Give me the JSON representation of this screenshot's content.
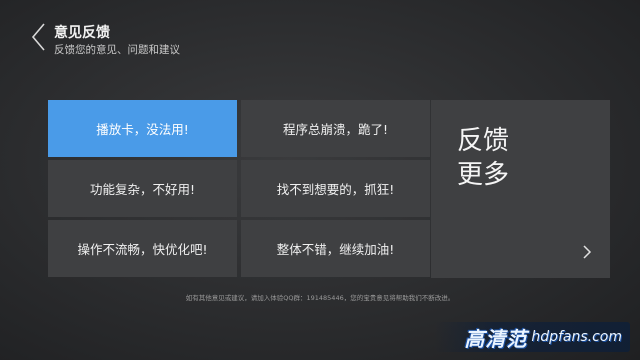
{
  "header": {
    "back_icon": "chevron-left-icon",
    "title": "意见反馈",
    "subtitle": "反馈您的意见、问题和建议"
  },
  "options": [
    {
      "label": "播放卡，没法用!",
      "selected": true
    },
    {
      "label": "程序总崩溃，跪了!",
      "selected": false
    },
    {
      "label": "功能复杂，不好用!",
      "selected": false
    },
    {
      "label": "找不到想要的，抓狂!",
      "selected": false
    },
    {
      "label": "操作不流畅，快优化吧!",
      "selected": false
    },
    {
      "label": "整体不错，继续加油!",
      "selected": false
    }
  ],
  "more": {
    "line1": "反馈",
    "line2": "更多",
    "arrow_icon": "chevron-right-icon"
  },
  "footer": {
    "text": "如有其他意见或建议，请加入体验QQ群：191485446，您的宝贵意见将帮助我们不断改进。"
  },
  "watermark": {
    "cn": "高清范",
    "en": "hdpfans.com"
  },
  "colors": {
    "background": "#2e2f31",
    "tile": "#3f4042",
    "selected": "#4a9be8"
  }
}
